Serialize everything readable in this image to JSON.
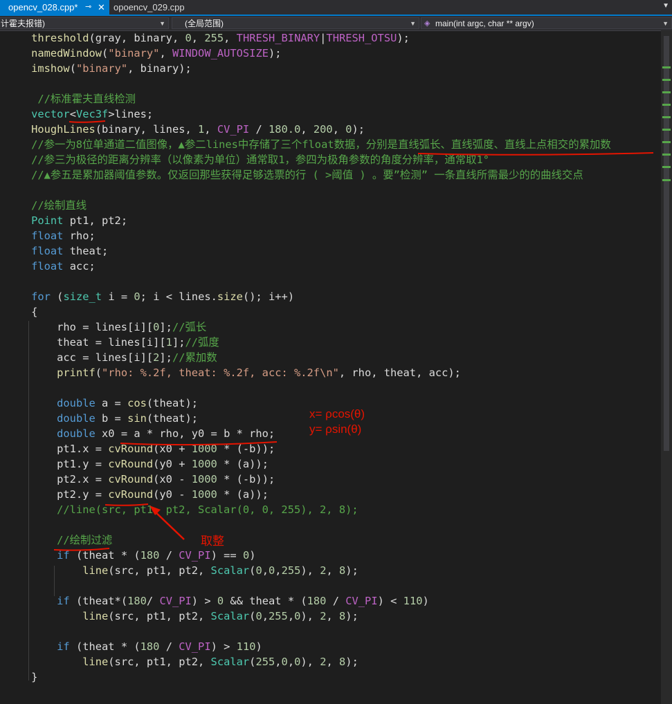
{
  "tabs": [
    {
      "label": "opencv_028.cpp*",
      "pin": "⊸",
      "close": "✕",
      "active": true
    },
    {
      "label": "opoencv_029.cpp",
      "active": false
    }
  ],
  "navbar": {
    "project": "计霍夫报错)",
    "scope": "(全局范围)",
    "member": "main(int argc, char ** argv)"
  },
  "code_lines": [
    [
      [
        "    ",
        "pl"
      ],
      [
        "threshold",
        "fn"
      ],
      [
        "(gray, binary, ",
        "pl"
      ],
      [
        "0",
        "nm"
      ],
      [
        ", ",
        "pl"
      ],
      [
        "255",
        "nm"
      ],
      [
        ", ",
        "pl"
      ],
      [
        "THRESH_BINARY",
        "mc"
      ],
      [
        "|",
        "pl"
      ],
      [
        "THRESH_OTSU",
        "mc"
      ],
      [
        ");",
        "pl"
      ]
    ],
    [
      [
        "    ",
        "pl"
      ],
      [
        "namedWindow",
        "fn"
      ],
      [
        "(",
        "pl"
      ],
      [
        "\"binary\"",
        "st"
      ],
      [
        ", ",
        "pl"
      ],
      [
        "WINDOW_AUTOSIZE",
        "mc"
      ],
      [
        ");",
        "pl"
      ]
    ],
    [
      [
        "    ",
        "pl"
      ],
      [
        "imshow",
        "fn"
      ],
      [
        "(",
        "pl"
      ],
      [
        "\"binary\"",
        "st"
      ],
      [
        ", binary);",
        "pl"
      ]
    ],
    [],
    [
      [
        "     //标准霍夫直线检测",
        "cm"
      ]
    ],
    [
      [
        "    ",
        "pl"
      ],
      [
        "vector",
        "ty"
      ],
      [
        "<",
        "pl"
      ],
      [
        "Vec3f",
        "ty"
      ],
      [
        ">",
        "pl"
      ],
      [
        "lines;",
        "pl"
      ]
    ],
    [
      [
        "    ",
        "pl"
      ],
      [
        "HoughLines",
        "fn"
      ],
      [
        "(binary, lines, ",
        "pl"
      ],
      [
        "1",
        "nm"
      ],
      [
        ", ",
        "pl"
      ],
      [
        "CV_PI",
        "mc"
      ],
      [
        " / ",
        "pl"
      ],
      [
        "180.0",
        "nm"
      ],
      [
        ", ",
        "pl"
      ],
      [
        "200",
        "nm"
      ],
      [
        ", ",
        "pl"
      ],
      [
        "0",
        "nm"
      ],
      [
        ");",
        "pl"
      ]
    ],
    [
      [
        "    //参一为8位单通道二值图像，▲参二lines中存储了三个float数据，分别是直线弧长、直线弧度、直线上点相交的累加数",
        "cm"
      ]
    ],
    [
      [
        "    //参三为极径的距离分辨率（以像素为单位）通常取1，参四为极角参数的角度分辨率，通常取1°",
        "cm"
      ]
    ],
    [
      [
        "    //▲参五是累加器阈值参数。仅返回那些获得足够选票的行 ( >阈值 ) 。要”检测” 一条直线所需最少的的曲线交点",
        "cm"
      ]
    ],
    [],
    [
      [
        "    //绘制直线",
        "cm"
      ]
    ],
    [
      [
        "    ",
        "pl"
      ],
      [
        "Point",
        "ty"
      ],
      [
        " pt1, pt2;",
        "pl"
      ]
    ],
    [
      [
        "    ",
        "pl"
      ],
      [
        "float",
        "kw"
      ],
      [
        " rho;",
        "pl"
      ]
    ],
    [
      [
        "    ",
        "pl"
      ],
      [
        "float",
        "kw"
      ],
      [
        " theat;",
        "pl"
      ]
    ],
    [
      [
        "    ",
        "pl"
      ],
      [
        "float",
        "kw"
      ],
      [
        " acc;",
        "pl"
      ]
    ],
    [],
    [
      [
        "    ",
        "pl"
      ],
      [
        "for",
        "kw"
      ],
      [
        " (",
        "pl"
      ],
      [
        "size_t",
        "ty"
      ],
      [
        " i = ",
        "pl"
      ],
      [
        "0",
        "nm"
      ],
      [
        "; i < lines.",
        "pl"
      ],
      [
        "size",
        "fn"
      ],
      [
        "(); i++)",
        "pl"
      ]
    ],
    [
      [
        "    {",
        "pl"
      ]
    ],
    [
      [
        "        rho = lines[i][",
        "pl"
      ],
      [
        "0",
        "nm"
      ],
      [
        "];",
        "pl"
      ],
      [
        "//弧长",
        "cm"
      ]
    ],
    [
      [
        "        theat = lines[i][",
        "pl"
      ],
      [
        "1",
        "nm"
      ],
      [
        "];",
        "pl"
      ],
      [
        "//弧度",
        "cm"
      ]
    ],
    [
      [
        "        acc = lines[i][",
        "pl"
      ],
      [
        "2",
        "nm"
      ],
      [
        "];",
        "pl"
      ],
      [
        "//累加数",
        "cm"
      ]
    ],
    [
      [
        "        ",
        "pl"
      ],
      [
        "printf",
        "fn"
      ],
      [
        "(",
        "pl"
      ],
      [
        "\"rho: %.2f, theat: %.2f, acc: %.2f\\n\"",
        "st"
      ],
      [
        ", rho, theat, acc);",
        "pl"
      ]
    ],
    [],
    [
      [
        "        ",
        "pl"
      ],
      [
        "double",
        "kw"
      ],
      [
        " a = ",
        "pl"
      ],
      [
        "cos",
        "fn"
      ],
      [
        "(theat);",
        "pl"
      ]
    ],
    [
      [
        "        ",
        "pl"
      ],
      [
        "double",
        "kw"
      ],
      [
        " b = ",
        "pl"
      ],
      [
        "sin",
        "fn"
      ],
      [
        "(theat);",
        "pl"
      ]
    ],
    [
      [
        "        ",
        "pl"
      ],
      [
        "double",
        "kw"
      ],
      [
        " x0 = a * rho, y0 = b * rho;",
        "pl"
      ]
    ],
    [
      [
        "        pt1.x = ",
        "pl"
      ],
      [
        "cvRound",
        "fn"
      ],
      [
        "(x0 + ",
        "pl"
      ],
      [
        "1000",
        "nm"
      ],
      [
        " * (-b));",
        "pl"
      ]
    ],
    [
      [
        "        pt1.y = ",
        "pl"
      ],
      [
        "cvRound",
        "fn"
      ],
      [
        "(y0 + ",
        "pl"
      ],
      [
        "1000",
        "nm"
      ],
      [
        " * (a));",
        "pl"
      ]
    ],
    [
      [
        "        pt2.x = ",
        "pl"
      ],
      [
        "cvRound",
        "fn"
      ],
      [
        "(x0 - ",
        "pl"
      ],
      [
        "1000",
        "nm"
      ],
      [
        " * (-b));",
        "pl"
      ]
    ],
    [
      [
        "        pt2.y = ",
        "pl"
      ],
      [
        "cvRound",
        "fn"
      ],
      [
        "(y0 - ",
        "pl"
      ],
      [
        "1000",
        "nm"
      ],
      [
        " * (a));",
        "pl"
      ]
    ],
    [
      [
        "        //line(src, pt1, pt2, Scalar(0, 0, 255), 2, 8);",
        "cm"
      ]
    ],
    [],
    [
      [
        "        //绘制过滤",
        "cm"
      ]
    ],
    [
      [
        "        ",
        "pl"
      ],
      [
        "if",
        "kw"
      ],
      [
        " (theat * (",
        "pl"
      ],
      [
        "180",
        "nm"
      ],
      [
        " / ",
        "pl"
      ],
      [
        "CV_PI",
        "mc"
      ],
      [
        ") == ",
        "pl"
      ],
      [
        "0",
        "nm"
      ],
      [
        ")",
        "pl"
      ]
    ],
    [
      [
        "            ",
        "pl"
      ],
      [
        "line",
        "fn"
      ],
      [
        "(src, pt1, pt2, ",
        "pl"
      ],
      [
        "Scalar",
        "ty"
      ],
      [
        "(",
        "pl"
      ],
      [
        "0",
        "nm"
      ],
      [
        ",",
        "pl"
      ],
      [
        "0",
        "nm"
      ],
      [
        ",",
        "pl"
      ],
      [
        "255",
        "nm"
      ],
      [
        "), ",
        "pl"
      ],
      [
        "2",
        "nm"
      ],
      [
        ", ",
        "pl"
      ],
      [
        "8",
        "nm"
      ],
      [
        ");",
        "pl"
      ]
    ],
    [],
    [
      [
        "        ",
        "pl"
      ],
      [
        "if",
        "kw"
      ],
      [
        " (theat*(",
        "pl"
      ],
      [
        "180",
        "nm"
      ],
      [
        "/ ",
        "pl"
      ],
      [
        "CV_PI",
        "mc"
      ],
      [
        ") > ",
        "pl"
      ],
      [
        "0",
        "nm"
      ],
      [
        " && theat * (",
        "pl"
      ],
      [
        "180",
        "nm"
      ],
      [
        " / ",
        "pl"
      ],
      [
        "CV_PI",
        "mc"
      ],
      [
        ") < ",
        "pl"
      ],
      [
        "110",
        "nm"
      ],
      [
        ")",
        "pl"
      ]
    ],
    [
      [
        "            ",
        "pl"
      ],
      [
        "line",
        "fn"
      ],
      [
        "(src, pt1, pt2, ",
        "pl"
      ],
      [
        "Scalar",
        "ty"
      ],
      [
        "(",
        "pl"
      ],
      [
        "0",
        "nm"
      ],
      [
        ",",
        "pl"
      ],
      [
        "255",
        "nm"
      ],
      [
        ",",
        "pl"
      ],
      [
        "0",
        "nm"
      ],
      [
        "), ",
        "pl"
      ],
      [
        "2",
        "nm"
      ],
      [
        ", ",
        "pl"
      ],
      [
        "8",
        "nm"
      ],
      [
        ");",
        "pl"
      ]
    ],
    [],
    [
      [
        "        ",
        "pl"
      ],
      [
        "if",
        "kw"
      ],
      [
        " (theat * (",
        "pl"
      ],
      [
        "180",
        "nm"
      ],
      [
        " / ",
        "pl"
      ],
      [
        "CV_PI",
        "mc"
      ],
      [
        ") > ",
        "pl"
      ],
      [
        "110",
        "nm"
      ],
      [
        ")",
        "pl"
      ]
    ],
    [
      [
        "            ",
        "pl"
      ],
      [
        "line",
        "fn"
      ],
      [
        "(src, pt1, pt2, ",
        "pl"
      ],
      [
        "Scalar",
        "ty"
      ],
      [
        "(",
        "pl"
      ],
      [
        "255",
        "nm"
      ],
      [
        ",",
        "pl"
      ],
      [
        "0",
        "nm"
      ],
      [
        ",",
        "pl"
      ],
      [
        "0",
        "nm"
      ],
      [
        "), ",
        "pl"
      ],
      [
        "2",
        "nm"
      ],
      [
        ", ",
        "pl"
      ],
      [
        "8",
        "nm"
      ],
      [
        ");",
        "pl"
      ]
    ],
    [
      [
        "    }",
        "pl"
      ]
    ]
  ],
  "annotations": {
    "formula_x": "x= ρcos(θ)",
    "formula_y": "y= ρsin(θ)",
    "round_note": "取整",
    "color": "#e51400"
  },
  "theme": {
    "background": "#1e1e1e",
    "accent": "#007acc"
  }
}
